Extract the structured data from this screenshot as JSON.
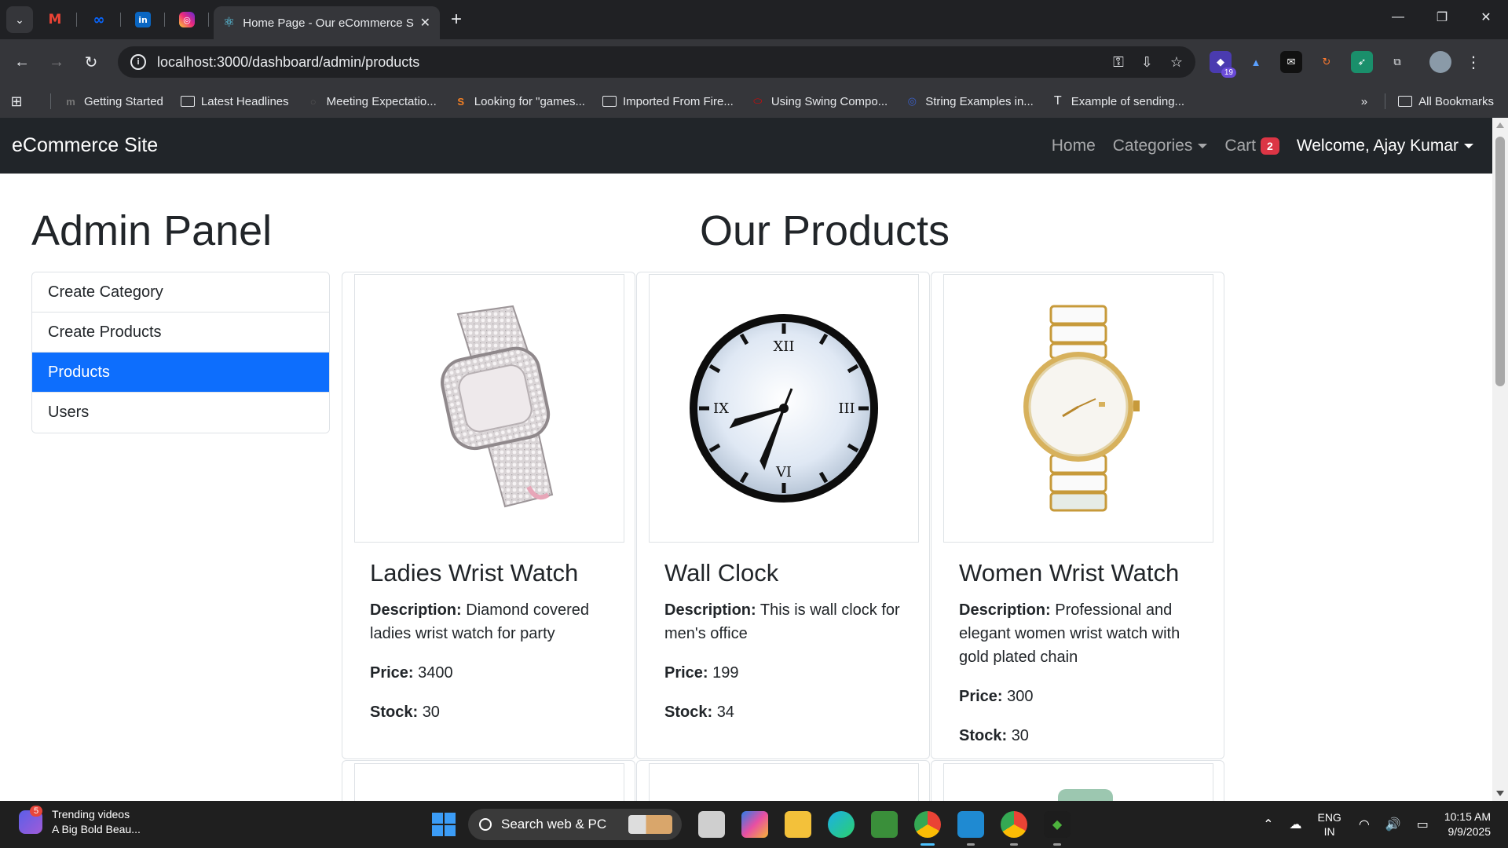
{
  "browser": {
    "active_tab_title": "Home Page - Our eCommerce Site",
    "url": "localhost:3000/dashboard/admin/products",
    "pinned_tabs": [
      "Gmail",
      "Meta",
      "LinkedIn",
      "Instagram"
    ],
    "extension_badge": "19",
    "bookmarks": [
      {
        "label": "Getting Started",
        "icon": "m-icon"
      },
      {
        "label": "Latest Headlines",
        "icon": "folder-icon"
      },
      {
        "label": "Meeting Expectatio...",
        "icon": "page-icon"
      },
      {
        "label": "Looking for \"games...",
        "icon": "so-icon"
      },
      {
        "label": "Imported From Fire...",
        "icon": "folder-icon"
      },
      {
        "label": "Using Swing Compo...",
        "icon": "oracle-icon"
      },
      {
        "label": "String Examples in...",
        "icon": "page-icon"
      },
      {
        "label": "Example of sending...",
        "icon": "t-icon"
      }
    ],
    "all_bookmarks": "All Bookmarks"
  },
  "nav": {
    "brand": "eCommerce Site",
    "home": "Home",
    "categories": "Categories",
    "cart": "Cart",
    "cart_count": "2",
    "welcome": "Welcome, Ajay Kumar"
  },
  "admin": {
    "title": "Admin Panel",
    "menu": [
      "Create Category",
      "Create Products",
      "Products",
      "Users"
    ],
    "active": "Products"
  },
  "products": {
    "title": "Our Products",
    "labels": {
      "description": "Description:",
      "price": "Price:",
      "stock": "Stock:"
    },
    "items": [
      {
        "name": "Ladies Wrist Watch",
        "description": "Diamond covered ladies wrist watch for party",
        "price": "3400",
        "stock": "30"
      },
      {
        "name": "Wall Clock",
        "description": "This is wall clock for men's office",
        "price": "199",
        "stock": "34"
      },
      {
        "name": "Women Wrist Watch",
        "description": "Professional and elegant women wrist watch with gold plated chain",
        "price": "300",
        "stock": "30"
      }
    ],
    "clock_numerals": [
      "XII",
      "III",
      "VI",
      "IX"
    ]
  },
  "taskbar": {
    "widget_badge": "5",
    "widget_title": "Trending videos",
    "widget_subtitle": "A Big Bold Beau...",
    "search_placeholder": "Search web & PC",
    "lang_top": "ENG",
    "lang_bottom": "IN",
    "time": "10:15 AM",
    "date": "9/9/2025"
  },
  "colors": {
    "primary": "#0d6efd",
    "navbar": "#212529",
    "cart_badge": "#dc3545"
  }
}
